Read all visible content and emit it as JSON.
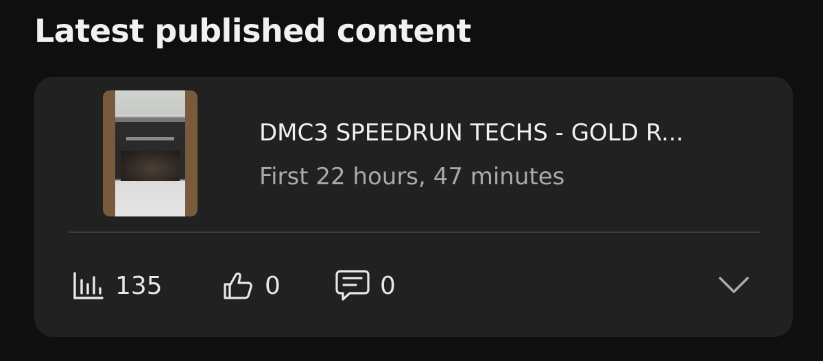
{
  "section": {
    "title": "Latest published content"
  },
  "content_card": {
    "thumbnail": {
      "icon": "video-thumbnail"
    },
    "video_title": "DMC3 SPEEDRUN TECHS - GOLD R...",
    "video_subtitle": "First 22 hours, 47 minutes",
    "stats": {
      "views": {
        "icon": "bar-chart-icon",
        "value": "135"
      },
      "likes": {
        "icon": "thumbs-up-icon",
        "value": "0"
      },
      "comments": {
        "icon": "comment-icon",
        "value": "0"
      }
    },
    "expand": {
      "icon": "chevron-down-icon"
    }
  },
  "colors": {
    "background": "#0f0f0f",
    "card": "#212121",
    "text_primary": "#f1f1f1",
    "text_secondary": "#aaaaaa"
  }
}
